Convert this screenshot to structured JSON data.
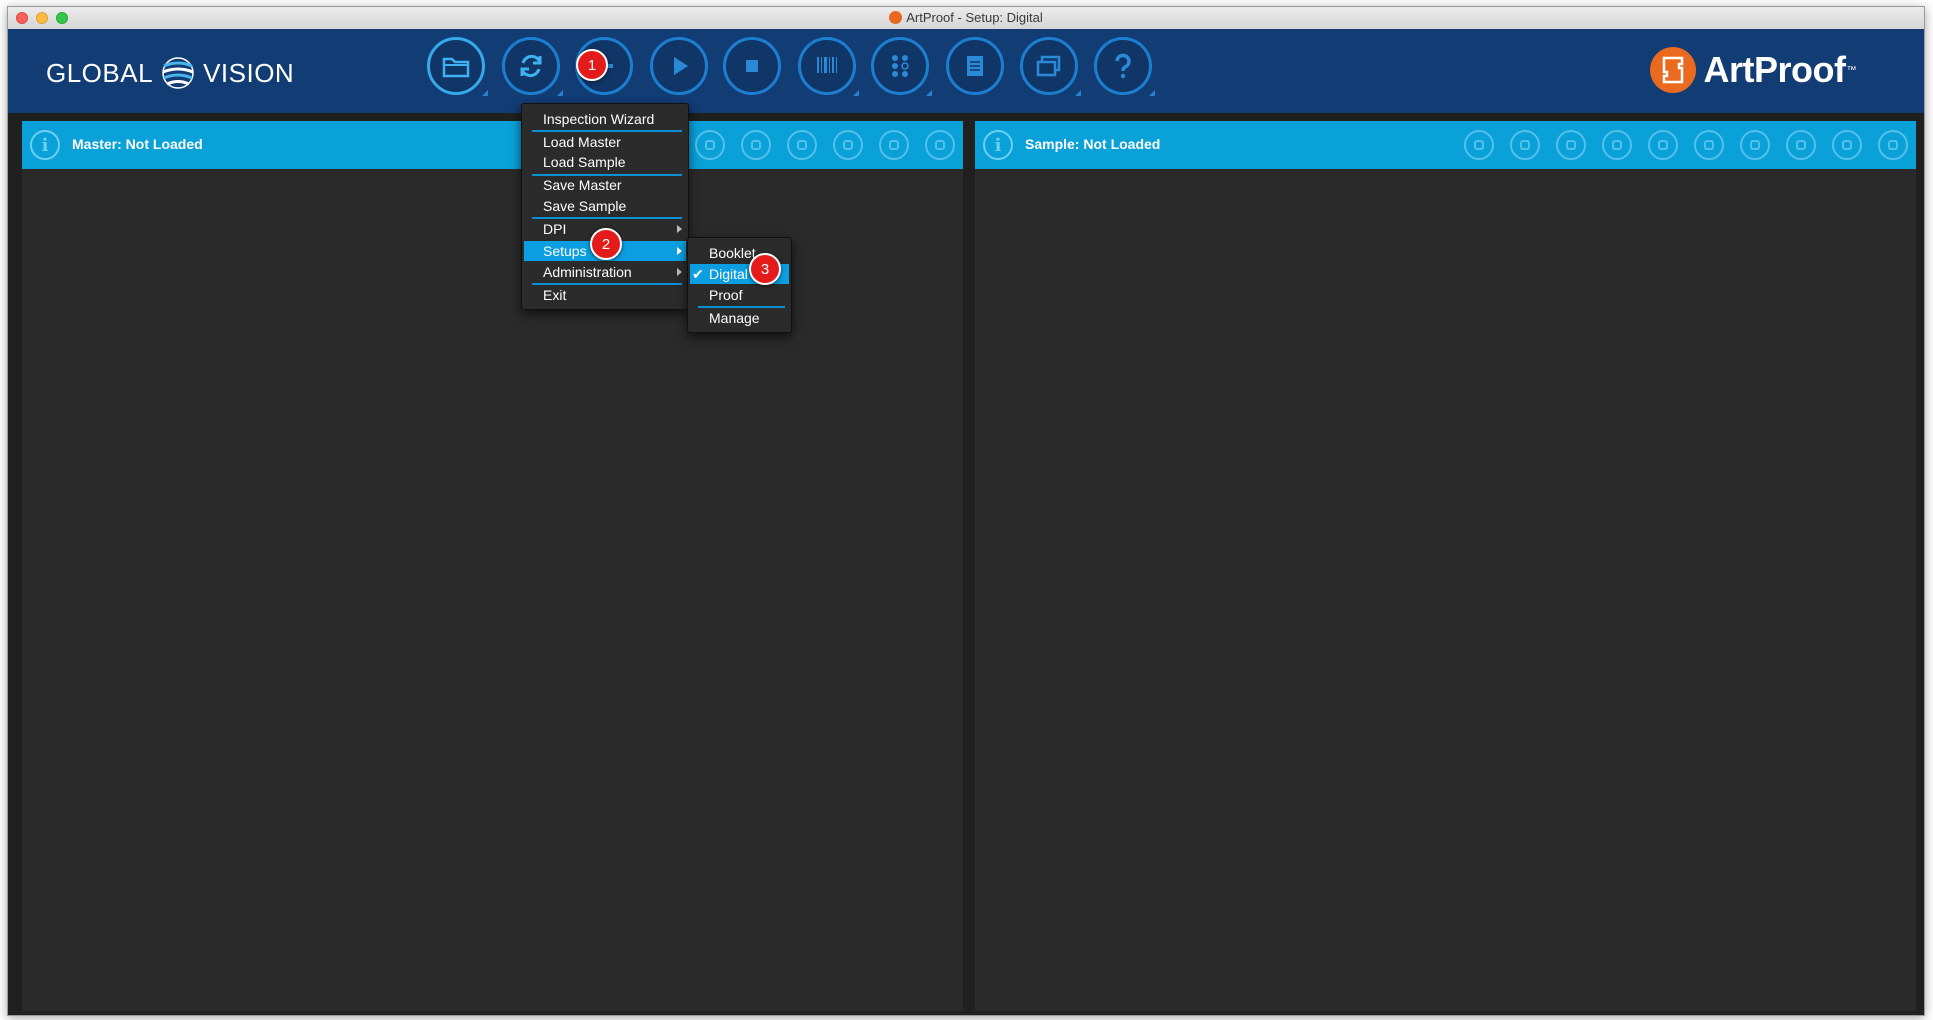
{
  "window": {
    "title": "ArtProof - Setup: Digital"
  },
  "toolbar": {
    "brand_left": {
      "word1": "GLOBAL",
      "word2": "VISION"
    },
    "brand_right": {
      "name": "ArtProof",
      "trademark": "™"
    },
    "buttons": [
      {
        "icon": "folder-open-icon",
        "active": true
      },
      {
        "icon": "refresh-icon"
      },
      {
        "icon": "back-arrow-icon"
      },
      {
        "icon": "play-icon"
      },
      {
        "icon": "stop-icon"
      },
      {
        "icon": "barcode-icon"
      },
      {
        "icon": "braille-icon"
      },
      {
        "icon": "notes-icon"
      },
      {
        "icon": "windows-icon"
      },
      {
        "icon": "help-icon"
      }
    ]
  },
  "master_panel": {
    "title": "Master: Not Loaded",
    "info_icon": "i"
  },
  "sample_panel": {
    "title": "Sample: Not Loaded",
    "info_icon": "i"
  },
  "file_menu": {
    "items": [
      {
        "label": "Inspection Wizard"
      },
      {
        "label": "Load Master"
      },
      {
        "label": "Load Sample"
      },
      {
        "label": "Save Master"
      },
      {
        "label": "Save Sample"
      },
      {
        "label": "DPI",
        "submenu": true
      },
      {
        "label": "Setups",
        "submenu": true,
        "highlighted": true
      },
      {
        "label": "Administration",
        "submenu": true
      },
      {
        "label": "Exit"
      }
    ]
  },
  "setups_submenu": {
    "items": [
      {
        "label": "Booklet"
      },
      {
        "label": "Digital",
        "checked": true
      },
      {
        "label": "Proof"
      },
      {
        "label": "Manage"
      }
    ],
    "check_glyph": "✔"
  },
  "callouts": [
    "1",
    "2",
    "3"
  ],
  "colors": {
    "toolbar_bg": "#123c74",
    "panel_header": "#0aa0d8",
    "menu_highlight": "#0b9ee0",
    "callout": "#e41b1b",
    "artproof_orange": "#ea6b1f"
  }
}
